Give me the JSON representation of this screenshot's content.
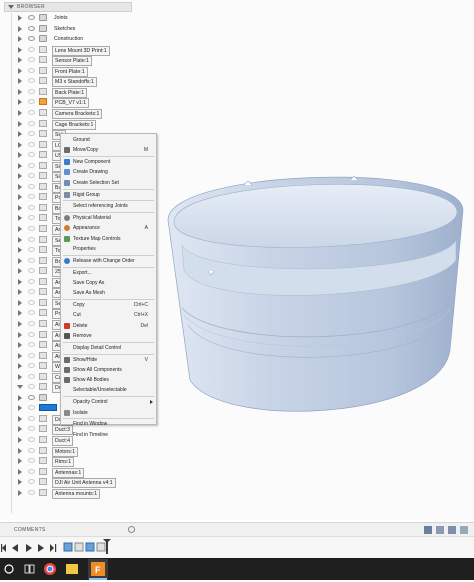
{
  "browser": {
    "title": "BROWSER",
    "items": [
      {
        "label": "Joints",
        "type": "folder",
        "arrow": "right"
      },
      {
        "label": "Sketches",
        "type": "folder",
        "arrow": "right"
      },
      {
        "label": "Construction",
        "type": "folder",
        "arrow": "right"
      },
      {
        "label": "Lens Mount 3D Print:1",
        "type": "comp",
        "arrow": "right"
      },
      {
        "label": "Sensor Plate:1",
        "type": "comp",
        "arrow": "right"
      },
      {
        "label": "Front Plate:1",
        "type": "comp",
        "arrow": "right"
      },
      {
        "label": "M3 x Standoffs:1",
        "type": "comp",
        "arrow": "right"
      },
      {
        "label": "Back Plate:1",
        "type": "comp",
        "arrow": "right"
      },
      {
        "label": "PCB_V7 v1:1",
        "type": "orange",
        "arrow": "right"
      },
      {
        "label": "Camera Brackets:1",
        "type": "comp",
        "arrow": "right"
      },
      {
        "label": "Cage Brackets:1",
        "type": "comp",
        "arrow": "right"
      },
      {
        "label": "Sid",
        "type": "comp",
        "arrow": "right"
      },
      {
        "label": "LC",
        "type": "comp",
        "arrow": "right"
      },
      {
        "label": "USB",
        "type": "comp",
        "arrow": "right"
      },
      {
        "label": "Sid",
        "type": "comp",
        "arrow": "right"
      },
      {
        "label": "Sid",
        "type": "comp",
        "arrow": "right"
      },
      {
        "label": "Bu",
        "type": "comp",
        "arrow": "right"
      },
      {
        "label": "Pow",
        "type": "comp",
        "arrow": "right"
      },
      {
        "label": "Bott",
        "type": "comp",
        "arrow": "right"
      },
      {
        "label": "Top",
        "type": "comp",
        "arrow": "right"
      },
      {
        "label": "Arm",
        "type": "comp",
        "arrow": "right"
      },
      {
        "label": "Sen",
        "type": "comp",
        "arrow": "right"
      },
      {
        "label": "Top",
        "type": "comp",
        "arrow": "right"
      },
      {
        "label": "Bott",
        "type": "comp",
        "arrow": "right"
      },
      {
        "label": "25m",
        "type": "comp",
        "arrow": "right"
      },
      {
        "label": "Arm",
        "type": "comp",
        "arrow": "right"
      },
      {
        "label": "Arm",
        "type": "comp",
        "arrow": "right"
      },
      {
        "label": "Sen",
        "type": "comp",
        "arrow": "right"
      },
      {
        "label": "Prop",
        "type": "comp",
        "arrow": "right"
      },
      {
        "label": "Air",
        "type": "comp",
        "arrow": "right"
      },
      {
        "label": "Air",
        "type": "comp",
        "arrow": "right"
      },
      {
        "label": "Air",
        "type": "comp",
        "arrow": "right"
      },
      {
        "label": "Air",
        "type": "comp",
        "arrow": "right"
      },
      {
        "label": "War",
        "type": "comp",
        "arrow": "right"
      },
      {
        "label": "Cam",
        "type": "comp",
        "arrow": "right"
      },
      {
        "label": "Duc",
        "type": "comp",
        "arrow": "down"
      },
      {
        "label": "",
        "type": "folder",
        "arrow": "right"
      },
      {
        "label": "",
        "type": "selected",
        "arrow": "right"
      },
      {
        "label": "Duct:2",
        "type": "comp",
        "arrow": "right"
      },
      {
        "label": "Duct:3",
        "type": "comp",
        "arrow": "right"
      },
      {
        "label": "Duct:4",
        "type": "comp",
        "arrow": "right"
      },
      {
        "label": "Motors:1",
        "type": "comp",
        "arrow": "right"
      },
      {
        "label": "Rims:1",
        "type": "comp",
        "arrow": "right"
      },
      {
        "label": "Antennas:1",
        "type": "comp",
        "arrow": "right"
      },
      {
        "label": "DJI Air Unit Antenna v4:1",
        "type": "comp",
        "arrow": "right"
      },
      {
        "label": "Antenna mounts:1",
        "type": "comp",
        "arrow": "right"
      }
    ]
  },
  "context_menu": {
    "items": [
      {
        "label": "Ground",
        "shortcut": "",
        "icon": "blank-icon"
      },
      {
        "label": "Move/Copy",
        "shortcut": "M",
        "icon": "move-icon"
      },
      {
        "sep": true
      },
      {
        "label": "New Component",
        "shortcut": "",
        "icon": "new-component-icon"
      },
      {
        "label": "Create Drawing",
        "shortcut": "",
        "icon": "drawing-icon"
      },
      {
        "label": "Create Selection Set",
        "shortcut": "",
        "icon": "selection-set-icon"
      },
      {
        "sep": true
      },
      {
        "label": "Rigid Group",
        "shortcut": "",
        "icon": "rigid-group-icon"
      },
      {
        "sep": true
      },
      {
        "label": "Select referencing Joints",
        "shortcut": "",
        "icon": "blank-icon"
      },
      {
        "sep": true
      },
      {
        "label": "Physical Material",
        "shortcut": "",
        "icon": "material-icon"
      },
      {
        "label": "Appearance",
        "shortcut": "A",
        "icon": "appearance-icon"
      },
      {
        "label": "Texture Map Controls",
        "shortcut": "",
        "icon": "texture-icon"
      },
      {
        "label": "Properties",
        "shortcut": "",
        "icon": "blank-icon"
      },
      {
        "sep": true
      },
      {
        "label": "Release with Change Order",
        "shortcut": "",
        "icon": "release-icon"
      },
      {
        "sep": true
      },
      {
        "label": "Export...",
        "shortcut": "",
        "icon": "blank-icon"
      },
      {
        "label": "Save Copy As",
        "shortcut": "",
        "icon": "blank-icon"
      },
      {
        "label": "Save As Mesh",
        "shortcut": "",
        "icon": "blank-icon"
      },
      {
        "sep": true
      },
      {
        "label": "Copy",
        "shortcut": "Ctrl+C",
        "icon": "blank-icon"
      },
      {
        "label": "Cut",
        "shortcut": "Ctrl+X",
        "icon": "blank-icon"
      },
      {
        "label": "Delete",
        "shortcut": "Del",
        "icon": "delete-icon"
      },
      {
        "label": "Remove",
        "shortcut": "",
        "icon": "remove-icon"
      },
      {
        "sep": true
      },
      {
        "label": "Display Detail Control",
        "shortcut": "",
        "icon": "blank-icon"
      },
      {
        "sep": true
      },
      {
        "label": "Show/Hide",
        "shortcut": "V",
        "icon": "eye-icon"
      },
      {
        "label": "Show All Components",
        "shortcut": "",
        "icon": "eye-icon"
      },
      {
        "label": "Show All Bodies",
        "shortcut": "",
        "icon": "eye-icon"
      },
      {
        "label": "Selectable/Unselectable",
        "shortcut": "",
        "icon": "blank-icon"
      },
      {
        "sep": true
      },
      {
        "label": "Opacity Control",
        "shortcut": "",
        "icon": "blank-icon",
        "submenu": true
      },
      {
        "label": "Isolate",
        "shortcut": "",
        "icon": "isolate-icon"
      },
      {
        "sep": true
      },
      {
        "label": "Find in Window",
        "shortcut": "",
        "icon": "blank-icon"
      },
      {
        "label": "Find in Timeline",
        "shortcut": "",
        "icon": "blank-icon"
      }
    ]
  },
  "comments": {
    "title": "COMMENTS"
  },
  "colors": {
    "ring_fill": "#c9d6e8",
    "ring_edge": "#8fa4c2",
    "selected_blue": "#1e7ad6",
    "taskbar": "#1f1f1f"
  }
}
